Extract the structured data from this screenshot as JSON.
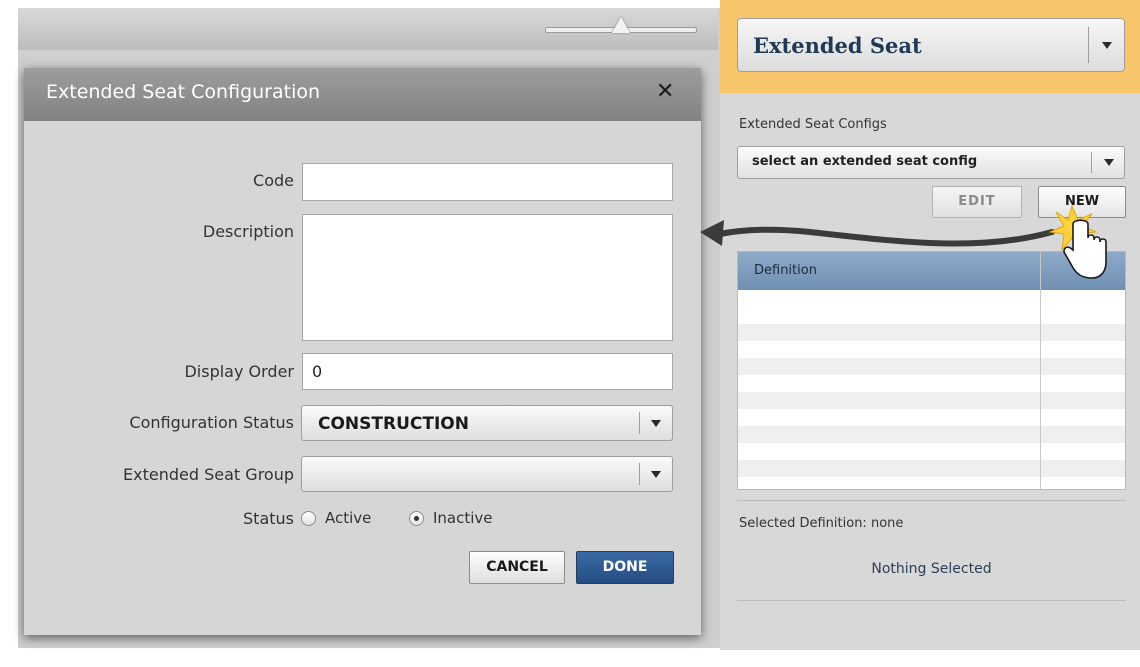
{
  "right_panel": {
    "header_select": "Extended Seat",
    "configs_label": "Extended Seat Configs",
    "configs_select": "select an extended seat config",
    "edit_button": "EDIT",
    "new_button": "NEW",
    "grid_header": "Definition",
    "selected_definition": "Selected Definition: none",
    "nothing_selected": "Nothing Selected"
  },
  "dialog": {
    "title": "Extended Seat Configuration",
    "close_icon": "close-icon",
    "code_label": "Code",
    "code_value": "",
    "description_label": "Description",
    "description_value": "",
    "display_order_label": "Display Order",
    "display_order_value": "0",
    "config_status_label": "Configuration Status",
    "config_status_value": "CONSTRUCTION",
    "seat_group_label": "Extended Seat Group",
    "seat_group_value": "",
    "status_label": "Status",
    "status_options": [
      "Active",
      "Inactive"
    ],
    "status_selected": "Inactive",
    "cancel_button": "CANCEL",
    "done_button": "DONE"
  },
  "colors": {
    "accent_header": "#f8c66a",
    "done_button": "#2b5a92",
    "grid_header": "#7f9dbd"
  },
  "icons": [
    "close-icon",
    "chevron-down-icon",
    "hand-pointer-icon",
    "curved-arrow-icon",
    "slider-icon"
  ]
}
